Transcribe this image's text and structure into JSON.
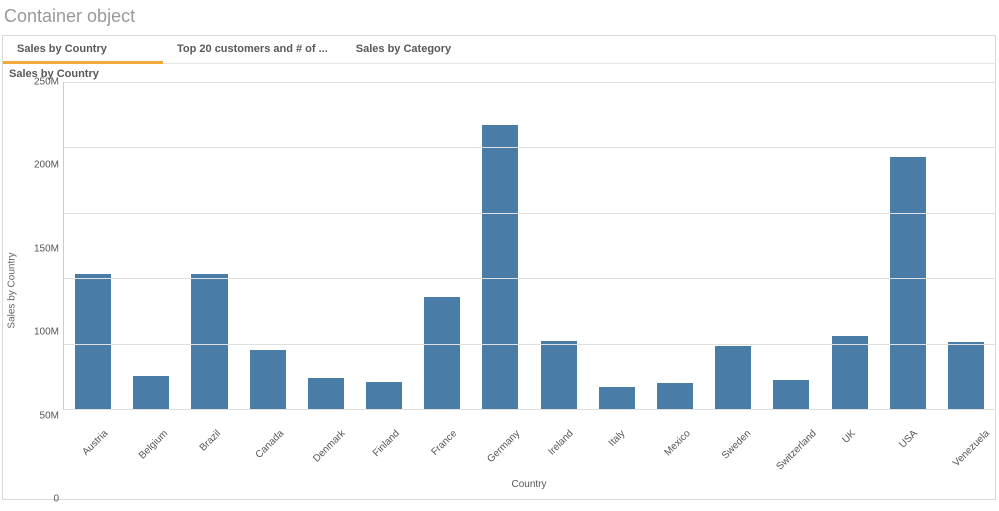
{
  "page_title": "Container object",
  "tabs": [
    {
      "label": "Sales by Country",
      "active": true
    },
    {
      "label": "Top 20 customers and # of ...",
      "active": false
    },
    {
      "label": "Sales by Category",
      "active": false
    }
  ],
  "chart_title": "Sales by Country",
  "chart_data": {
    "type": "bar",
    "title": "Sales by Country",
    "xlabel": "Country",
    "ylabel": "Sales by Country",
    "ylim": [
      0,
      250000000
    ],
    "yticks": [
      0,
      50000000,
      100000000,
      150000000,
      200000000,
      250000000
    ],
    "ytick_labels": [
      "0",
      "50M",
      "100M",
      "150M",
      "200M",
      "250M"
    ],
    "categories": [
      "Austria",
      "Belgium",
      "Brazil",
      "Canada",
      "Denmark",
      "Finland",
      "France",
      "Germany",
      "Ireland",
      "Italy",
      "Mexico",
      "Sweden",
      "Switzerland",
      "UK",
      "USA",
      "Venezuela"
    ],
    "values": [
      103000000,
      25000000,
      103000000,
      45000000,
      24000000,
      21000000,
      86000000,
      217000000,
      52000000,
      17000000,
      20000000,
      48000000,
      22000000,
      56000000,
      193000000,
      51000000
    ],
    "bar_color": "#4a7ca8"
  }
}
